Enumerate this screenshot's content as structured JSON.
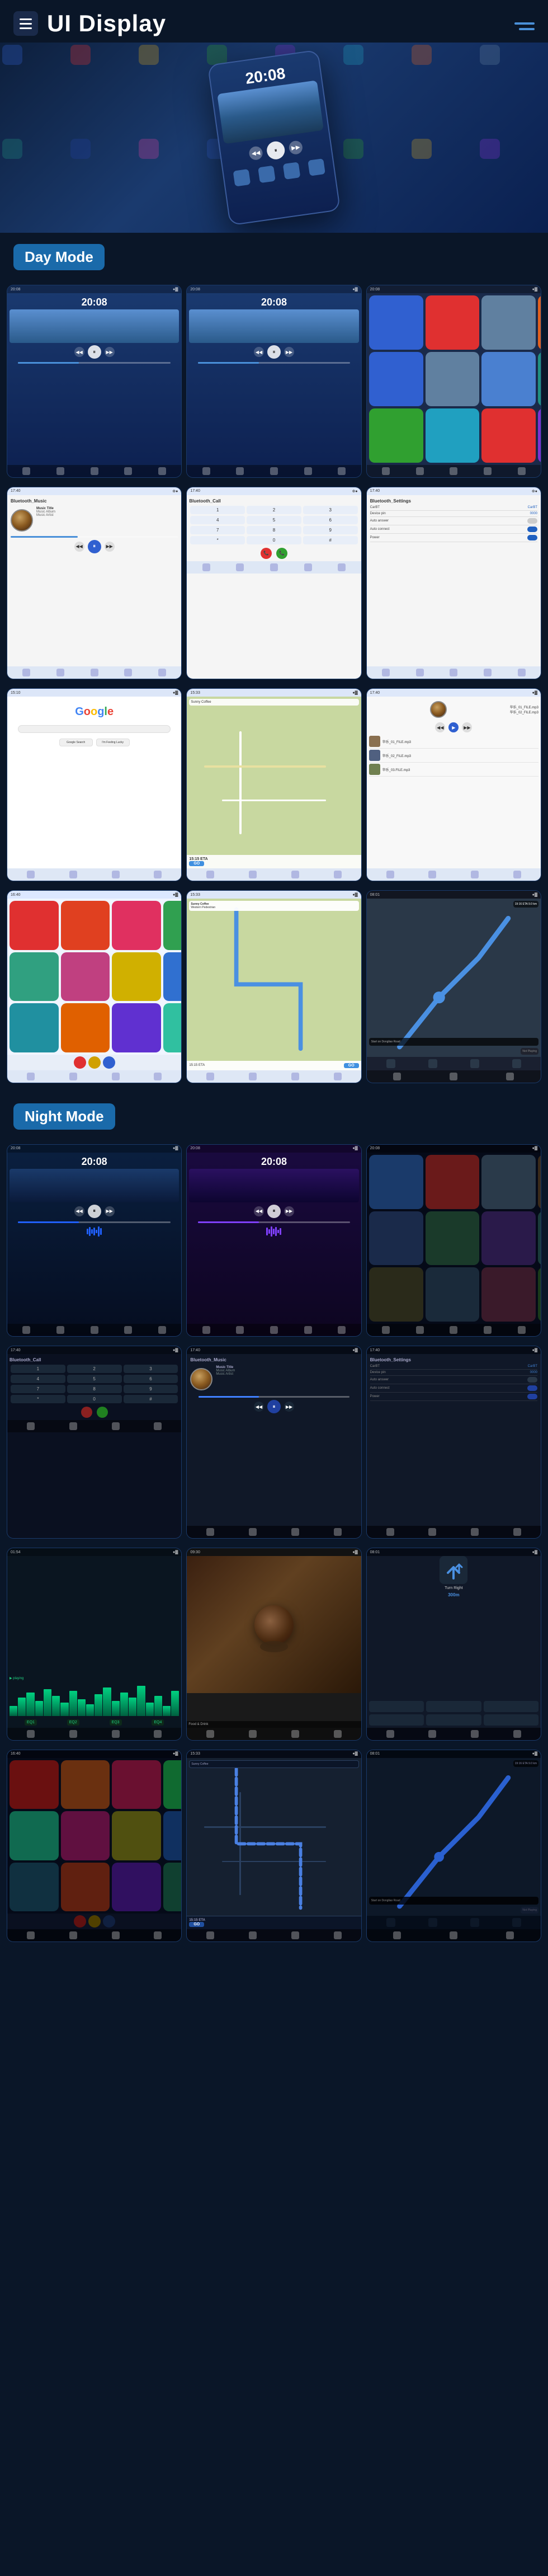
{
  "header": {
    "title": "UI Display",
    "menu_icon_label": "Menu",
    "hamburger_lines": 3
  },
  "day_mode": {
    "label": "Day Mode"
  },
  "night_mode": {
    "label": "Night Mode"
  },
  "music": {
    "time": "20:08",
    "title": "Music Title",
    "album": "Music Album",
    "artist": "Music Artist",
    "title_night": "Music Title",
    "album_night": "Music Album",
    "artist_night": "Music Artist"
  },
  "bluetooth": {
    "music_label": "Bluetooth_Music",
    "call_label": "Bluetooth_Call",
    "settings_label": "Bluetooth_Settings",
    "device_name": "CarBT",
    "device_pin": "0000",
    "auto_answer": "Auto answer",
    "auto_connect": "Auto connect",
    "power": "Power"
  },
  "google": {
    "logo": "Google"
  },
  "navigation": {
    "restaurant": "Sunny Coffee",
    "address": "Western Pedestrian",
    "go_btn": "GO",
    "eta_label": "15:15 ETA",
    "distance": "9.0 km",
    "road": "Start on Dongliao Road",
    "not_playing": "Not Playing"
  },
  "local_music": {
    "files": [
      "华乐_01_FILE.mp3",
      "华乐_02_FILE.mp3",
      "华乐_03.FILE.mp3"
    ]
  },
  "eq_bars": [
    20,
    45,
    60,
    40,
    70,
    55,
    35,
    65,
    50,
    30,
    45,
    60,
    40,
    55,
    35,
    70,
    45,
    55,
    30,
    65
  ],
  "wave_bars": [
    10,
    18,
    25,
    30,
    22,
    35,
    28,
    20,
    32,
    25,
    18,
    28,
    35,
    22,
    30
  ],
  "statusbar": {
    "time_left": "20:08",
    "time_right": "17:40",
    "signal": "●●●",
    "battery": "▓▓▓"
  }
}
